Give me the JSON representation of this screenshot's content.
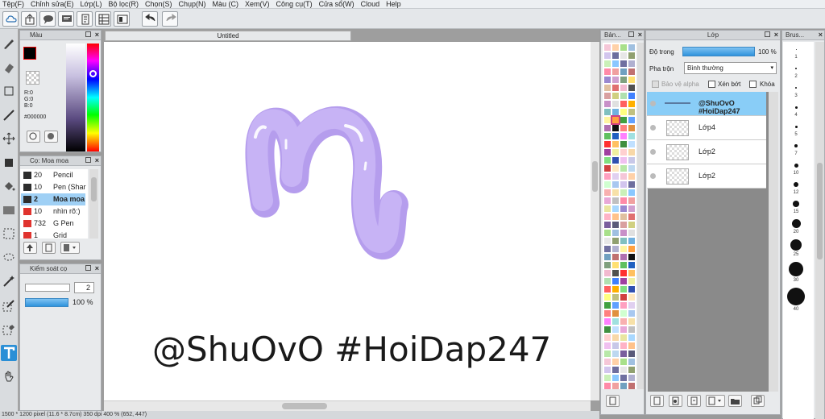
{
  "menu": [
    "Tệp(F)",
    "Chỉnh sửa(E)",
    "Lớp(L)",
    "Bộ lọc(R)",
    "Chọn(S)",
    "Chụp(N)",
    "Màu (C)",
    "Xem(V)",
    "Công cụ(T)",
    "Cửa sổ(W)",
    "Cloud",
    "Help"
  ],
  "toolbar_icons": [
    "cloud-icon",
    "share-icon",
    "comment-icon",
    "message-icon",
    "document-icon",
    "grid-doc-icon",
    "layout-icon",
    "undo-icon",
    "redo-icon"
  ],
  "tools": [
    "brush-icon",
    "eraser-icon",
    "shape-icon",
    "line-icon",
    "move-icon",
    "fill-square-icon",
    "bucket-icon",
    "gradient-icon",
    "select-rect-icon",
    "lasso-icon",
    "magic-wand-icon",
    "select-pen-icon",
    "select-eraser-icon",
    "text-icon",
    "hand-icon"
  ],
  "color_panel": {
    "title": "Màu",
    "r": "R:0",
    "g": "G:0",
    "b": "B:0",
    "hex": "#000000",
    "fg": "#000000",
    "accent": "#ff0000"
  },
  "brush_panel": {
    "title": "Cọ: Moa moa",
    "rows": [
      {
        "size": "20",
        "name": "Pencil",
        "color": "#2d2d2d"
      },
      {
        "size": "10",
        "name": "Pen (Shar",
        "color": "#2d2d2d"
      },
      {
        "size": "2",
        "name": "Moa moa",
        "color": "#2d2d2d",
        "selected": true
      },
      {
        "size": "10",
        "name": "nhìn rõ:)",
        "color": "#e0332e"
      },
      {
        "size": "732",
        "name": "G Pen",
        "color": "#e0332e"
      },
      {
        "size": "1",
        "name": "Grid",
        "color": "#e0332e"
      }
    ]
  },
  "brush_control": {
    "title": "Kiểm soát cọ",
    "size": "2",
    "opacity": "100 %"
  },
  "document": {
    "tab": "Untitled",
    "watermark": "@ShuOvO #HoiDap247"
  },
  "statusbar": "1500 * 1200 pixel (11.6 * 8.7cm) 350 dpi 400 % (652, 447)",
  "swatch_panel": {
    "title": "Bản..."
  },
  "layer_panel": {
    "title": "Lớp",
    "opacity_label": "Độ trong",
    "opacity_value": "100 %",
    "blend_label": "Pha trộn",
    "blend_value": "Bình thường",
    "protect_alpha": "Bảo vệ alpha",
    "clipping": "Xén bớt",
    "lock": "Khóa",
    "layers": [
      {
        "name": "@ShuOvO #HoiDap247",
        "selected": true,
        "text": true
      },
      {
        "name": "Lớp4"
      },
      {
        "name": "Lớp2"
      },
      {
        "name": "Lớp2"
      }
    ]
  },
  "brush_size_panel": {
    "title": "Brus...",
    "sizes": [
      "1",
      "2",
      "3",
      "4",
      "5",
      "7",
      "10",
      "12",
      "15",
      "20",
      "25",
      "30",
      "40"
    ]
  }
}
